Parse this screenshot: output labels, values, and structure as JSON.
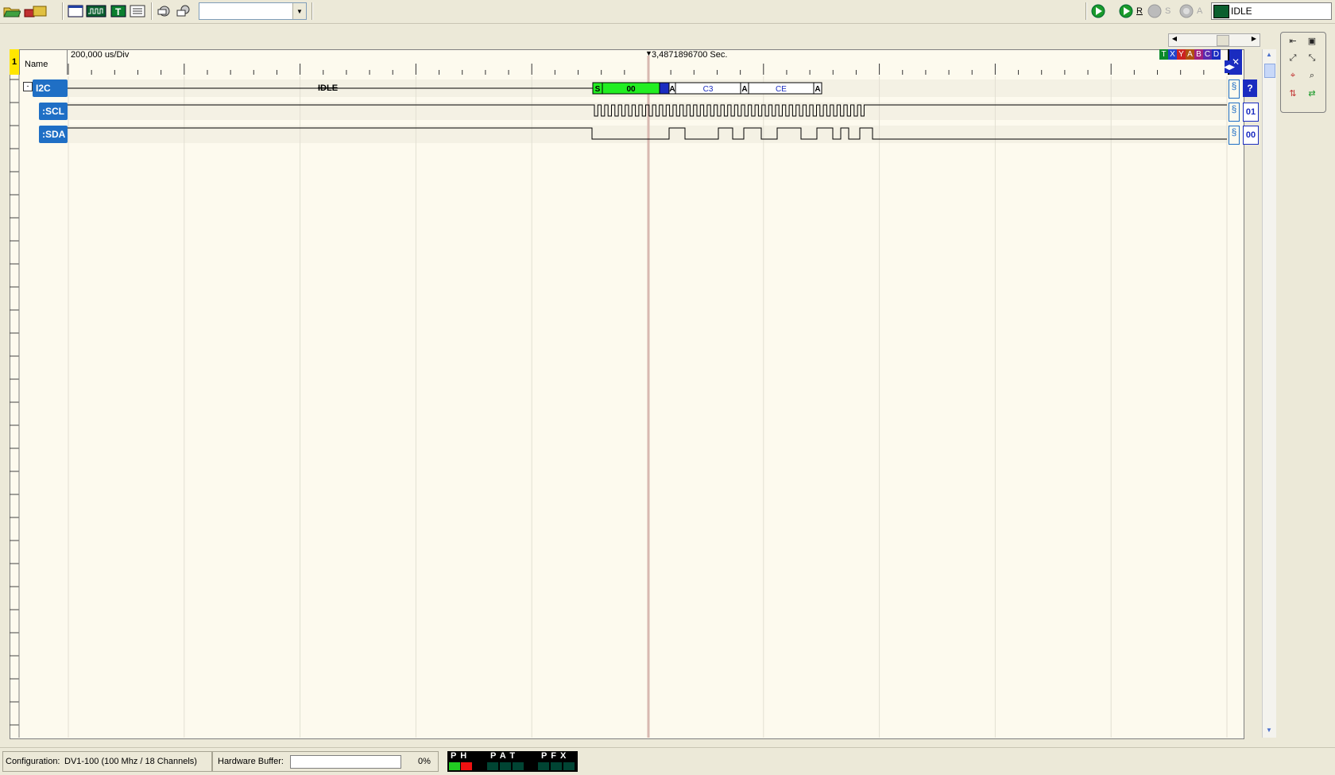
{
  "toolbar": {
    "buttons": [
      "open-icon",
      "save-icon",
      "window-icon",
      "waveform-icon",
      "text-icon",
      "list-icon",
      "config-icon",
      "config2-icon"
    ],
    "combo_value": "",
    "status_text": "IDLE",
    "run_labels": {
      "r": "R",
      "s": "S",
      "a": "A"
    }
  },
  "ruler": {
    "name_header": "Name",
    "time_div": "200,000 us/Div",
    "cursor_time": "3,4871896700 Sec.",
    "panel_number": "1",
    "cursor_buttons": [
      "T",
      "X",
      "Y",
      "A",
      "B",
      "C",
      "D"
    ]
  },
  "channels": [
    {
      "label": "I2C",
      "value": "?"
    },
    {
      "label": ":SCL",
      "value": "01"
    },
    {
      "label": ":SDA",
      "value": "00"
    }
  ],
  "i2c_decode": {
    "idle": "IDLE",
    "start": "S",
    "byte1": "00",
    "ack1": "A",
    "byte2": "C3",
    "ack2": "A",
    "byte3": "CE",
    "ack3": "A"
  },
  "bottom": {
    "config_label": "Configuration:",
    "config_value": "DV1-100 (100 Mhz / 18 Channels)",
    "buffer_label": "Hardware Buffer:",
    "buffer_percent": "0%",
    "indicators_group1": "P H",
    "indicators_group2": "P A T",
    "indicators_group3": "P F X"
  },
  "colors": {
    "accent_blue": "#1f6fc5",
    "start_green": "#22ee22",
    "panel_bg": "#fdfaee"
  }
}
